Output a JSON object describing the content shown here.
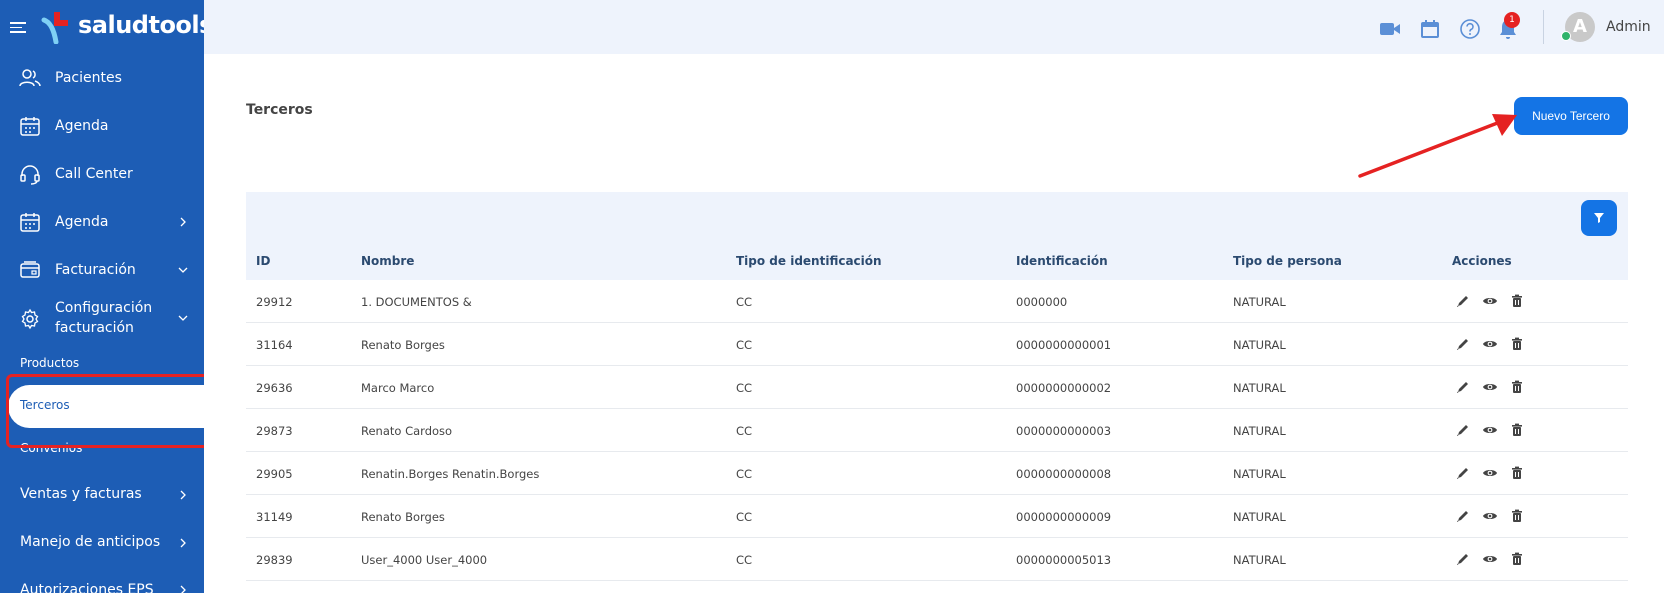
{
  "brand": {
    "name": "saludtools"
  },
  "sidebar": {
    "items": [
      {
        "label": "Pacientes"
      },
      {
        "label": "Agenda"
      },
      {
        "label": "Call Center"
      },
      {
        "label": "Agenda"
      },
      {
        "label": "Facturación"
      },
      {
        "label": "Configuración facturación"
      }
    ],
    "sub_items": [
      {
        "label": "Productos"
      },
      {
        "label": "Terceros"
      },
      {
        "label": "Convenios"
      }
    ],
    "bottom_items": [
      {
        "label": "Ventas y facturas"
      },
      {
        "label": "Manejo de anticipos"
      },
      {
        "label": "Autorizaciones EPS"
      }
    ]
  },
  "topbar": {
    "notifications_count": "1",
    "avatar_initial": "A",
    "user_name": "Admin"
  },
  "main": {
    "title": "Terceros",
    "new_button_label": "Nuevo Tercero"
  },
  "table": {
    "columns": [
      "ID",
      "Nombre",
      "Tipo de identificación",
      "Identificación",
      "Tipo de persona",
      "Acciones"
    ],
    "rows": [
      {
        "id": "29912",
        "nombre": "1. DOCUMENTOS &",
        "tipo_id": "CC",
        "identificacion": "0000000",
        "tipo_persona": "NATURAL"
      },
      {
        "id": "31164",
        "nombre": "Renato Borges",
        "tipo_id": "CC",
        "identificacion": "0000000000001",
        "tipo_persona": "NATURAL"
      },
      {
        "id": "29636",
        "nombre": "Marco Marco",
        "tipo_id": "CC",
        "identificacion": "0000000000002",
        "tipo_persona": "NATURAL"
      },
      {
        "id": "29873",
        "nombre": "Renato Cardoso",
        "tipo_id": "CC",
        "identificacion": "0000000000003",
        "tipo_persona": "NATURAL"
      },
      {
        "id": "29905",
        "nombre": "Renatin.Borges Renatin.Borges",
        "tipo_id": "CC",
        "identificacion": "0000000000008",
        "tipo_persona": "NATURAL"
      },
      {
        "id": "31149",
        "nombre": "Renato Borges",
        "tipo_id": "CC",
        "identificacion": "0000000000009",
        "tipo_persona": "NATURAL"
      },
      {
        "id": "29839",
        "nombre": "User_4000 User_4000",
        "tipo_id": "CC",
        "identificacion": "0000000005013",
        "tipo_persona": "NATURAL"
      }
    ]
  },
  "colors": {
    "sidebar": "#1d5db5",
    "accent": "#1474e5",
    "annotation": "#e52222",
    "header_bg": "#eef3fc"
  }
}
